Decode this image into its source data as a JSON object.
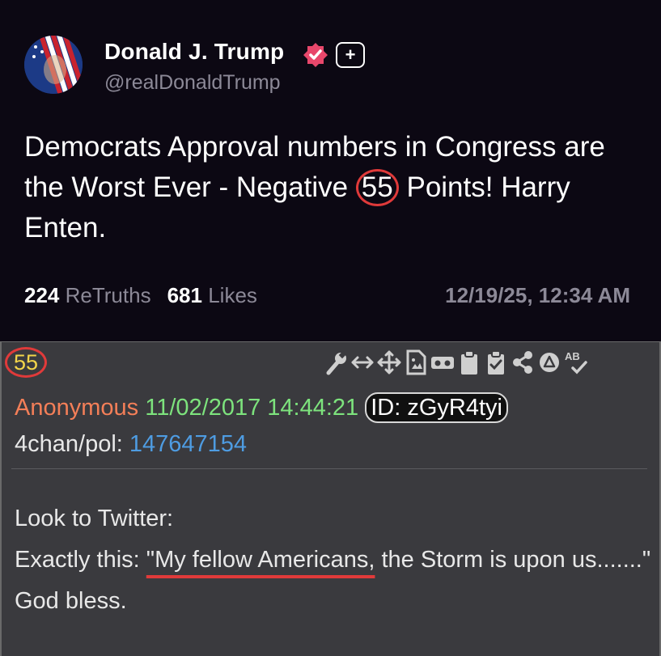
{
  "truth_post": {
    "author": {
      "name": "Donald J. Trump",
      "handle": "@realDonaldTrump"
    },
    "text_before": "Democrats Approval numbers in Congress are the Worst Ever - Negative",
    "text_highlight": "55",
    "text_after": "Points! Harry Enten.",
    "retruths_count": "224",
    "retruths_label": "ReTruths",
    "likes_count": "681",
    "likes_label": "Likes",
    "timestamp": "12/19/25, 12:34 AM",
    "plus_badge": "+"
  },
  "q_post": {
    "post_number": "55",
    "name": "Anonymous",
    "date": "11/02/2017 14:44:21",
    "id": "ID: zGyR4tyi",
    "board": "4chan/pol:",
    "thread": "147647154",
    "body_line1": "Look to Twitter:",
    "body_prefix": "Exactly this: ",
    "body_highlight": "\"My fellow Americans,",
    "body_suffix": " the Storm is upon us.......\"",
    "body_line3": "God bless."
  },
  "colors": {
    "accent_circle": "#e03a3a",
    "post_number": "#f3d54a",
    "anon_name": "#f47f58",
    "date": "#7de37d",
    "link": "#4e9ce2",
    "verified": "#e8476b"
  },
  "icons": [
    "wrench-icon",
    "arrows-horizontal-icon",
    "move-icon",
    "document-icon",
    "vr-goggles-icon",
    "clipboard-icon",
    "clipboard-check-icon",
    "share-icon",
    "triangle-circle-icon",
    "spellcheck-icon"
  ]
}
